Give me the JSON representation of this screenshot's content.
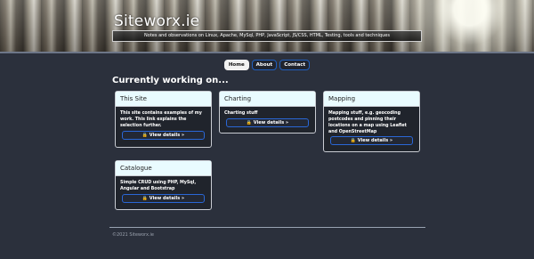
{
  "header": {
    "site_title": "Siteworx.ie",
    "tagline": "Notes and observations on Linux, Apache, MySql, PHP, JavaScript, JS/CSS, HTML, Testing, tools and techniques"
  },
  "nav": {
    "items": [
      {
        "label": "Home",
        "active": true
      },
      {
        "label": "About",
        "active": false
      },
      {
        "label": "Contact",
        "active": false
      }
    ]
  },
  "main": {
    "section_title": "Currently working on...",
    "cards": [
      {
        "title": "This Site",
        "body": "This site contains examples of my work. This link explains the selection further.",
        "button": "🔒 View details »"
      },
      {
        "title": "Charting",
        "body": "Charting stuff",
        "button": "🔒 View details »"
      },
      {
        "title": "Mapping",
        "body": "Mapping stuff, e.g. geocoding postcodes and pinning their locations on a map using Leaflet and OpenStreetMap",
        "button": "🔒 View details »"
      },
      {
        "title": "Catalogue",
        "body": "Simple CRUD using PHP, MySql, Angular and Bootstrap",
        "button": "🔒 View details »"
      }
    ]
  },
  "footer": {
    "text": "©2021 Siteworx.ie"
  }
}
